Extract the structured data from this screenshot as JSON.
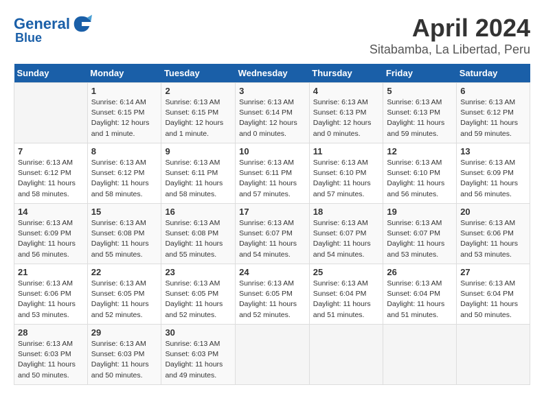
{
  "header": {
    "logo_line1": "General",
    "logo_line2": "Blue",
    "title": "April 2024",
    "subtitle": "Sitabamba, La Libertad, Peru"
  },
  "weekdays": [
    "Sunday",
    "Monday",
    "Tuesday",
    "Wednesday",
    "Thursday",
    "Friday",
    "Saturday"
  ],
  "weeks": [
    [
      {
        "day": "",
        "info": ""
      },
      {
        "day": "1",
        "info": "Sunrise: 6:14 AM\nSunset: 6:15 PM\nDaylight: 12 hours\nand 1 minute."
      },
      {
        "day": "2",
        "info": "Sunrise: 6:13 AM\nSunset: 6:15 PM\nDaylight: 12 hours\nand 1 minute."
      },
      {
        "day": "3",
        "info": "Sunrise: 6:13 AM\nSunset: 6:14 PM\nDaylight: 12 hours\nand 0 minutes."
      },
      {
        "day": "4",
        "info": "Sunrise: 6:13 AM\nSunset: 6:13 PM\nDaylight: 12 hours\nand 0 minutes."
      },
      {
        "day": "5",
        "info": "Sunrise: 6:13 AM\nSunset: 6:13 PM\nDaylight: 11 hours\nand 59 minutes."
      },
      {
        "day": "6",
        "info": "Sunrise: 6:13 AM\nSunset: 6:12 PM\nDaylight: 11 hours\nand 59 minutes."
      }
    ],
    [
      {
        "day": "7",
        "info": "Sunrise: 6:13 AM\nSunset: 6:12 PM\nDaylight: 11 hours\nand 58 minutes."
      },
      {
        "day": "8",
        "info": "Sunrise: 6:13 AM\nSunset: 6:12 PM\nDaylight: 11 hours\nand 58 minutes."
      },
      {
        "day": "9",
        "info": "Sunrise: 6:13 AM\nSunset: 6:11 PM\nDaylight: 11 hours\nand 58 minutes."
      },
      {
        "day": "10",
        "info": "Sunrise: 6:13 AM\nSunset: 6:11 PM\nDaylight: 11 hours\nand 57 minutes."
      },
      {
        "day": "11",
        "info": "Sunrise: 6:13 AM\nSunset: 6:10 PM\nDaylight: 11 hours\nand 57 minutes."
      },
      {
        "day": "12",
        "info": "Sunrise: 6:13 AM\nSunset: 6:10 PM\nDaylight: 11 hours\nand 56 minutes."
      },
      {
        "day": "13",
        "info": "Sunrise: 6:13 AM\nSunset: 6:09 PM\nDaylight: 11 hours\nand 56 minutes."
      }
    ],
    [
      {
        "day": "14",
        "info": "Sunrise: 6:13 AM\nSunset: 6:09 PM\nDaylight: 11 hours\nand 56 minutes."
      },
      {
        "day": "15",
        "info": "Sunrise: 6:13 AM\nSunset: 6:08 PM\nDaylight: 11 hours\nand 55 minutes."
      },
      {
        "day": "16",
        "info": "Sunrise: 6:13 AM\nSunset: 6:08 PM\nDaylight: 11 hours\nand 55 minutes."
      },
      {
        "day": "17",
        "info": "Sunrise: 6:13 AM\nSunset: 6:07 PM\nDaylight: 11 hours\nand 54 minutes."
      },
      {
        "day": "18",
        "info": "Sunrise: 6:13 AM\nSunset: 6:07 PM\nDaylight: 11 hours\nand 54 minutes."
      },
      {
        "day": "19",
        "info": "Sunrise: 6:13 AM\nSunset: 6:07 PM\nDaylight: 11 hours\nand 53 minutes."
      },
      {
        "day": "20",
        "info": "Sunrise: 6:13 AM\nSunset: 6:06 PM\nDaylight: 11 hours\nand 53 minutes."
      }
    ],
    [
      {
        "day": "21",
        "info": "Sunrise: 6:13 AM\nSunset: 6:06 PM\nDaylight: 11 hours\nand 53 minutes."
      },
      {
        "day": "22",
        "info": "Sunrise: 6:13 AM\nSunset: 6:05 PM\nDaylight: 11 hours\nand 52 minutes."
      },
      {
        "day": "23",
        "info": "Sunrise: 6:13 AM\nSunset: 6:05 PM\nDaylight: 11 hours\nand 52 minutes."
      },
      {
        "day": "24",
        "info": "Sunrise: 6:13 AM\nSunset: 6:05 PM\nDaylight: 11 hours\nand 52 minutes."
      },
      {
        "day": "25",
        "info": "Sunrise: 6:13 AM\nSunset: 6:04 PM\nDaylight: 11 hours\nand 51 minutes."
      },
      {
        "day": "26",
        "info": "Sunrise: 6:13 AM\nSunset: 6:04 PM\nDaylight: 11 hours\nand 51 minutes."
      },
      {
        "day": "27",
        "info": "Sunrise: 6:13 AM\nSunset: 6:04 PM\nDaylight: 11 hours\nand 50 minutes."
      }
    ],
    [
      {
        "day": "28",
        "info": "Sunrise: 6:13 AM\nSunset: 6:03 PM\nDaylight: 11 hours\nand 50 minutes."
      },
      {
        "day": "29",
        "info": "Sunrise: 6:13 AM\nSunset: 6:03 PM\nDaylight: 11 hours\nand 50 minutes."
      },
      {
        "day": "30",
        "info": "Sunrise: 6:13 AM\nSunset: 6:03 PM\nDaylight: 11 hours\nand 49 minutes."
      },
      {
        "day": "",
        "info": ""
      },
      {
        "day": "",
        "info": ""
      },
      {
        "day": "",
        "info": ""
      },
      {
        "day": "",
        "info": ""
      }
    ]
  ]
}
